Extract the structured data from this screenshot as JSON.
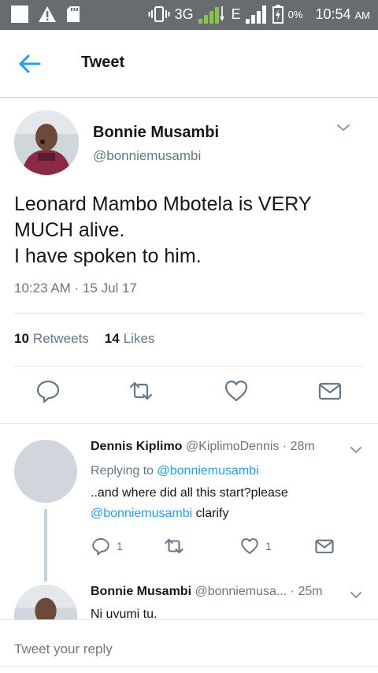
{
  "status_bar": {
    "network": "3G",
    "network2": "E",
    "battery": "0%",
    "time": "10:54",
    "time_suffix": "AM"
  },
  "header": {
    "title": "Tweet"
  },
  "tweet": {
    "author_name": "Bonnie Musambi",
    "author_handle": "@bonniemusambi",
    "text_lines": [
      "Leonard Mambo Mbotela is VERY",
      "MUCH alive.",
      "I have spoken to him."
    ],
    "timestamp": "10:23 AM · 15 Jul 17",
    "retweets_count": "10",
    "retweets_label": "Retweets",
    "likes_count": "14",
    "likes_label": "Likes"
  },
  "replies": [
    {
      "name": "Dennis Kiplimo",
      "handle": "@KiplimoDennis",
      "time": "· 28m",
      "replying_prefix": "Replying to",
      "replying_to": "@bonniemusambi",
      "text_line1": "..and where did all this start?please",
      "text_link": "@bonniemusambi",
      "text_line2_rest": "clarify",
      "reply_count": "1",
      "like_count": "1"
    },
    {
      "name": "Bonnie Musambi",
      "handle": "@bonniemusa...",
      "time": "· 25m",
      "text": "Ni uvumi tu."
    }
  ],
  "reply_bar": {
    "placeholder": "Tweet your reply"
  },
  "colors": {
    "accent": "#1da1f2",
    "muted": "#657786",
    "status_bar": "#676c70",
    "signal_green": "#8bc34a"
  }
}
